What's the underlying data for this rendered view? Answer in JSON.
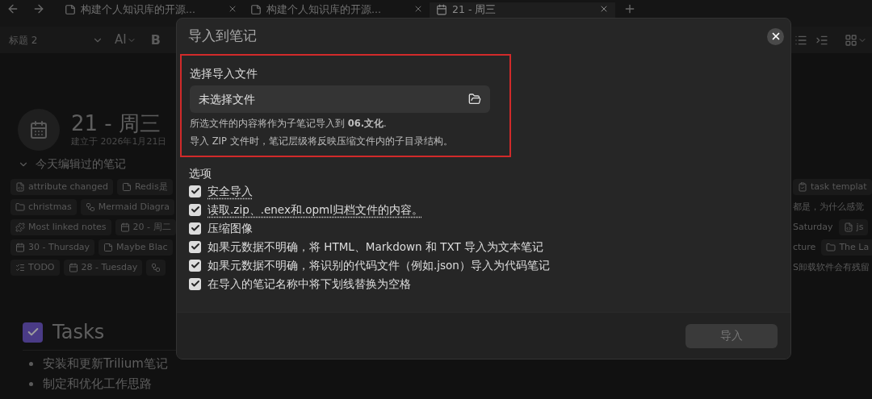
{
  "tabs": [
    {
      "label": "构建个人知识库的开源...",
      "kind": "note",
      "selected": false
    },
    {
      "label": "构建个人知识库的开源...",
      "kind": "note",
      "selected": false
    },
    {
      "label": "21 - 周三",
      "kind": "calendar",
      "selected": true
    }
  ],
  "toolbar": {
    "heading": "标题 2",
    "ai": "AI",
    "bold": "B"
  },
  "note": {
    "title": "21 - 周三",
    "created": "建立于 2026年1月21日",
    "section": "今天编辑过的笔记",
    "chip_rows": [
      {
        "left": [
          {
            "kind": "code",
            "label": "attribute changed"
          },
          {
            "kind": "note",
            "label": "Redis是"
          }
        ],
        "right": [
          {
            "kind": "task",
            "label": "task templat"
          }
        ]
      },
      {
        "left": [
          {
            "kind": "folder",
            "label": "christmas"
          },
          {
            "kind": "diagram",
            "label": "Mermaid Diagra"
          }
        ],
        "right": [
          {
            "kind": "plain",
            "label": "都是，为什么感觉"
          }
        ]
      },
      {
        "left": [
          {
            "kind": "puzzle",
            "label": "Most linked notes"
          },
          {
            "kind": "calendar",
            "label": "20 - 周二"
          }
        ],
        "right": [
          {
            "kind": "plain",
            "label": "Saturday"
          },
          {
            "kind": "code",
            "label": "js"
          }
        ]
      },
      {
        "left": [
          {
            "kind": "calendar",
            "label": "30 - Thursday"
          },
          {
            "kind": "note",
            "label": "Maybe Blac"
          }
        ],
        "right": [
          {
            "kind": "plain",
            "label": "cture"
          },
          {
            "kind": "folder",
            "label": "The La"
          }
        ]
      },
      {
        "left": [
          {
            "kind": "todo",
            "label": "TODO"
          },
          {
            "kind": "calendar",
            "label": "28 - Tuesday"
          },
          {
            "kind": "diagram"
          }
        ],
        "right": [
          {
            "kind": "plain",
            "label": "S卸载软件会有残留"
          }
        ]
      }
    ],
    "tasks": {
      "title": "Tasks",
      "checked": true,
      "items": [
        "安装和更新Trilium笔记",
        "制定和优化工作思路"
      ]
    }
  },
  "dialog": {
    "title": "导入到笔记",
    "file": {
      "label": "选择导入文件",
      "value": "未选择文件",
      "highlighted": true,
      "help": [
        "所选文件的内容将作为子笔记导入到 **06.文化**.",
        "导入 ZIP 文件时，笔记层级将反映压缩文件内的子目录结构。"
      ]
    },
    "options_label": "选项",
    "options": [
      {
        "label": "安全导入",
        "checked": true,
        "hint": true
      },
      {
        "label": "读取.zip、.enex和.opml归档文件的内容。",
        "checked": true,
        "hint": true
      },
      {
        "label": "压缩图像",
        "checked": true,
        "hint": false
      },
      {
        "label": "如果元数据不明确，将 HTML、Markdown 和 TXT 导入为文本笔记",
        "checked": true,
        "hint": false
      },
      {
        "label": "如果元数据不明确，将识别的代码文件（例如.json）导入为代码笔记",
        "checked": true,
        "hint": false
      },
      {
        "label": "在导入的笔记名称中将下划线替换为空格",
        "checked": true,
        "hint": false
      }
    ],
    "submit": {
      "label": "导入",
      "disabled": true
    }
  }
}
